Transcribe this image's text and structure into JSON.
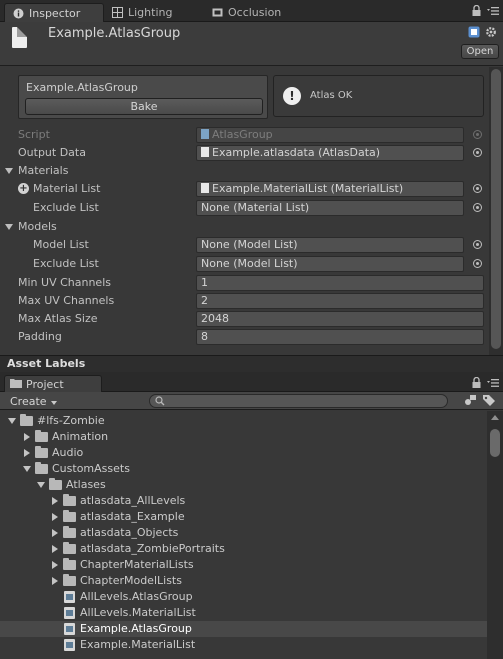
{
  "inspector": {
    "tabs": [
      {
        "label": "Inspector",
        "icon": "info-icon",
        "active": true
      },
      {
        "label": "Lighting",
        "icon": "lighting-icon",
        "active": false
      },
      {
        "label": "Occlusion",
        "icon": "occlusion-icon",
        "active": false
      }
    ],
    "header": {
      "title": "Example.AtlasGroup",
      "open_label": "Open",
      "icon": "file-icon"
    },
    "bake_box": {
      "title": "Example.AtlasGroup",
      "bake_label": "Bake"
    },
    "help_box": {
      "icon": "!",
      "text": "Atlas OK"
    },
    "properties": {
      "script": {
        "label": "Script",
        "value": "AtlasGroup"
      },
      "output_data": {
        "label": "Output Data",
        "value": "Example.atlasdata (AtlasData)"
      },
      "materials": {
        "label": "Materials"
      },
      "material_list": {
        "label": "Material List",
        "value": "Example.MaterialList (MaterialList)"
      },
      "exclude_list_materials": {
        "label": "Exclude List",
        "value": "None (Material List)"
      },
      "models": {
        "label": "Models"
      },
      "model_list": {
        "label": "Model List",
        "value": "None (Model List)"
      },
      "exclude_list_models": {
        "label": "Exclude List",
        "value": "None (Model List)"
      },
      "min_uv": {
        "label": "Min UV Channels",
        "value": "1"
      },
      "max_uv": {
        "label": "Max UV Channels",
        "value": "2"
      },
      "max_atlas": {
        "label": "Max Atlas Size",
        "value": "2048"
      },
      "padding": {
        "label": "Padding",
        "value": "8"
      }
    }
  },
  "asset_labels": {
    "label": "Asset Labels"
  },
  "project": {
    "tab_label": "Project",
    "create_label": "Create",
    "search_placeholder": "",
    "tree": [
      {
        "label": "#lfs-Zombie",
        "type": "folder",
        "depth": 0,
        "expanded": true
      },
      {
        "label": "Animation",
        "type": "folder",
        "depth": 1,
        "expanded": false
      },
      {
        "label": "Audio",
        "type": "folder",
        "depth": 1,
        "expanded": false
      },
      {
        "label": "CustomAssets",
        "type": "folder",
        "depth": 1,
        "expanded": true
      },
      {
        "label": "Atlases",
        "type": "folder",
        "depth": 2,
        "expanded": true
      },
      {
        "label": "atlasdata_AllLevels",
        "type": "folder",
        "depth": 3,
        "expanded": false
      },
      {
        "label": "atlasdata_Example",
        "type": "folder",
        "depth": 3,
        "expanded": false
      },
      {
        "label": "atlasdata_Objects",
        "type": "folder",
        "depth": 3,
        "expanded": false
      },
      {
        "label": "atlasdata_ZombiePortraits",
        "type": "folder",
        "depth": 3,
        "expanded": false
      },
      {
        "label": "ChapterMaterialLists",
        "type": "folder",
        "depth": 3,
        "expanded": false
      },
      {
        "label": "ChapterModelLists",
        "type": "folder",
        "depth": 3,
        "expanded": false
      },
      {
        "label": "AllLevels.AtlasGroup",
        "type": "asset",
        "depth": 3,
        "selected": false
      },
      {
        "label": "AllLevels.MaterialList",
        "type": "asset",
        "depth": 3,
        "selected": false
      },
      {
        "label": "Example.AtlasGroup",
        "type": "asset",
        "depth": 3,
        "selected": true
      },
      {
        "label": "Example.MaterialList",
        "type": "asset",
        "depth": 3,
        "selected": false
      }
    ]
  },
  "colors": {
    "background": "#383838",
    "tabbar": "#2a2a2a",
    "field": "#505050",
    "selection": "#484848"
  }
}
